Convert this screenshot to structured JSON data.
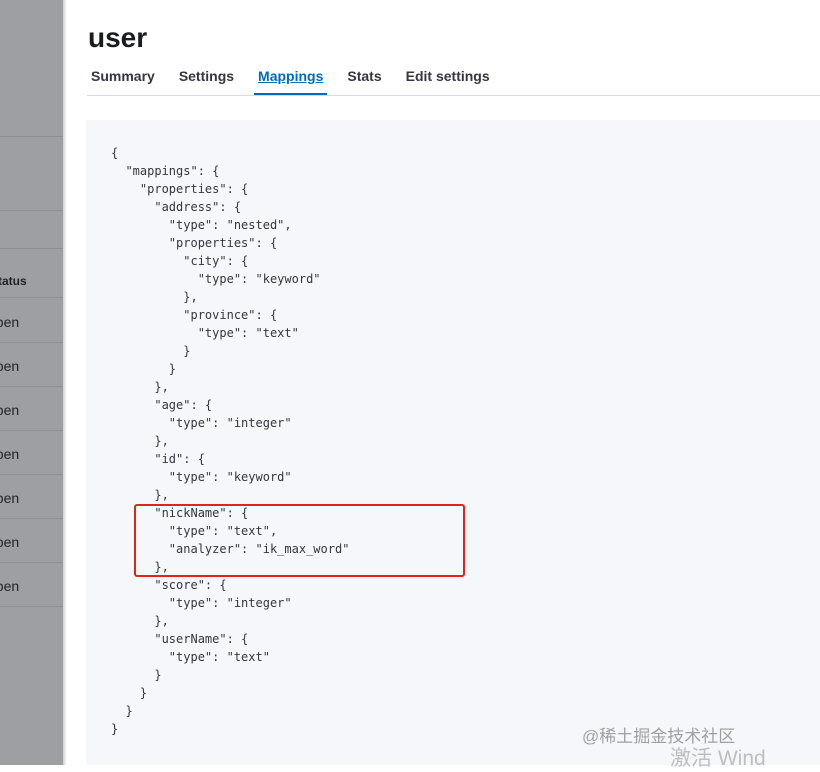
{
  "background_table": {
    "header": "Status",
    "rows": [
      "open",
      "open",
      "open",
      "open",
      "open",
      "open",
      "open"
    ]
  },
  "flyout": {
    "title": "user",
    "tabs": [
      {
        "label": "Summary",
        "active": false
      },
      {
        "label": "Settings",
        "active": false
      },
      {
        "label": "Mappings",
        "active": true
      },
      {
        "label": "Stats",
        "active": false
      },
      {
        "label": "Edit settings",
        "active": false
      }
    ],
    "code_lines": [
      "{",
      "  \"mappings\": {",
      "    \"properties\": {",
      "      \"address\": {",
      "        \"type\": \"nested\",",
      "        \"properties\": {",
      "          \"city\": {",
      "            \"type\": \"keyword\"",
      "          },",
      "          \"province\": {",
      "            \"type\": \"text\"",
      "          }",
      "        }",
      "      },",
      "      \"age\": {",
      "        \"type\": \"integer\"",
      "      },",
      "      \"id\": {",
      "        \"type\": \"keyword\"",
      "      },",
      "      \"nickName\": {",
      "        \"type\": \"text\",",
      "        \"analyzer\": \"ik_max_word\"",
      "      },",
      "      \"score\": {",
      "        \"type\": \"integer\"",
      "      },",
      "      \"userName\": {",
      "        \"type\": \"text\"",
      "      }",
      "    }",
      "  }",
      "}"
    ],
    "highlight_color": "#e2231a",
    "accent_color": "#006bb8"
  },
  "watermark": {
    "text": "@稀土掘金技术社区",
    "os_text": "激活 Wind"
  }
}
